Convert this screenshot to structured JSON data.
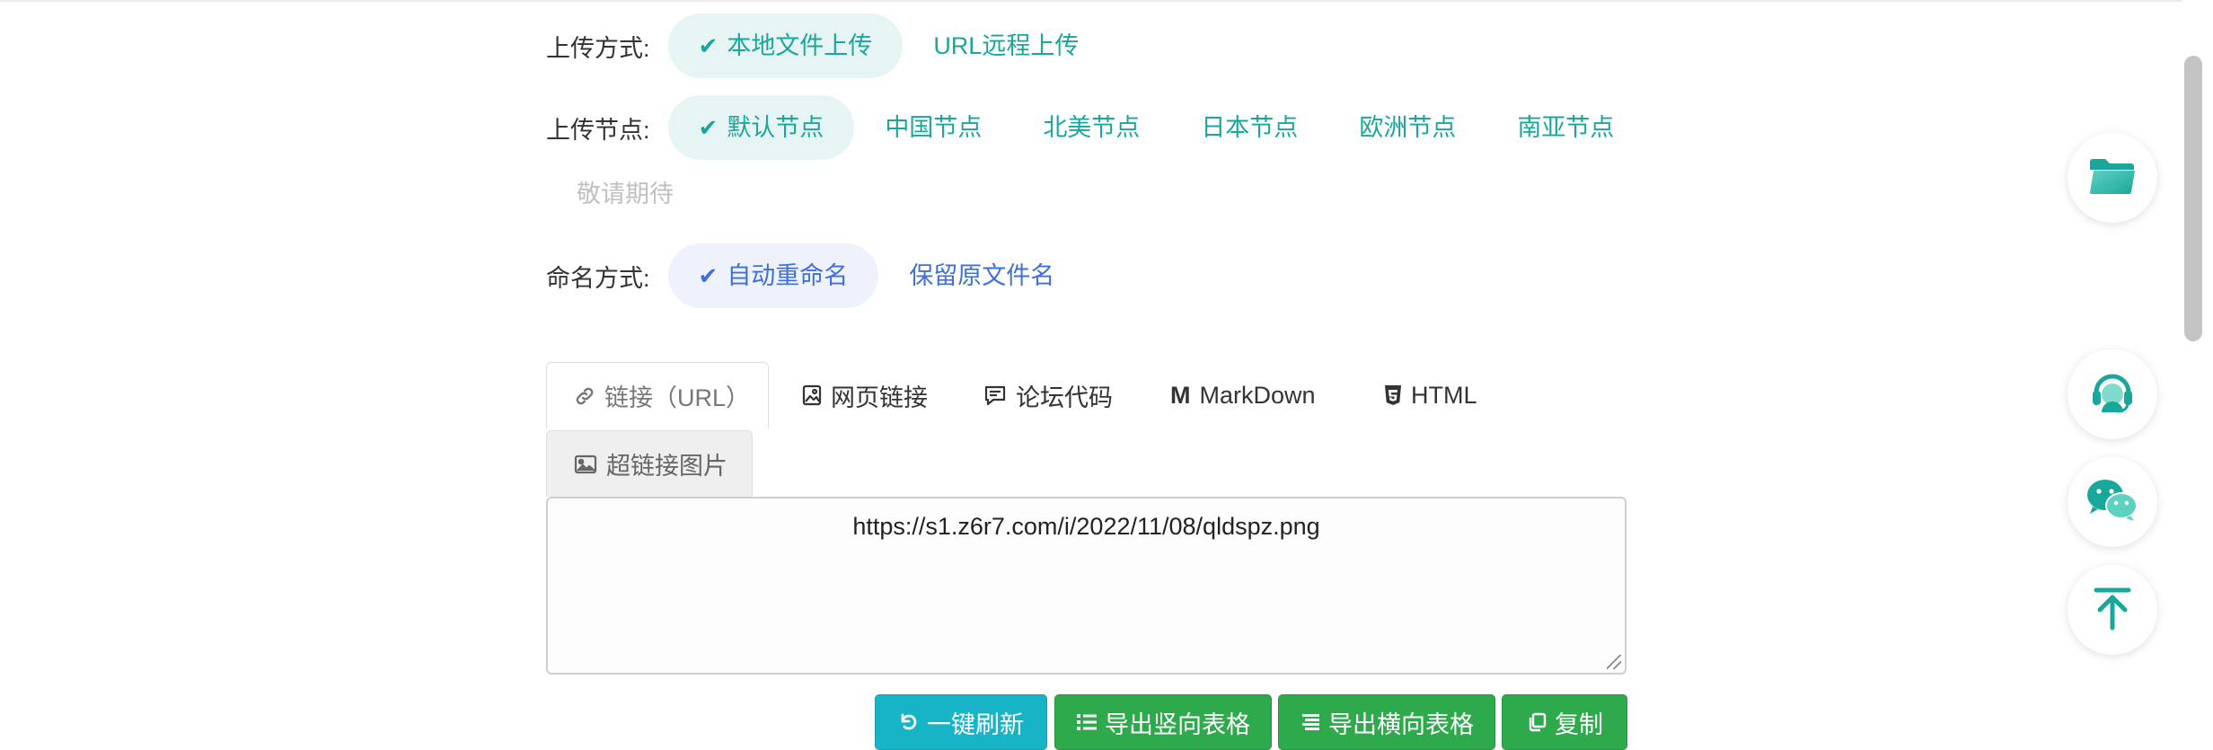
{
  "upload_method": {
    "label": "上传方式:",
    "options": [
      {
        "label": "本地文件上传",
        "active": true
      },
      {
        "label": "URL远程上传",
        "active": false
      }
    ]
  },
  "upload_node": {
    "label": "上传节点:",
    "options": [
      {
        "label": "默认节点",
        "active": true
      },
      {
        "label": "中国节点",
        "active": false
      },
      {
        "label": "北美节点",
        "active": false
      },
      {
        "label": "日本节点",
        "active": false
      },
      {
        "label": "欧洲节点",
        "active": false
      },
      {
        "label": "南亚节点",
        "active": false
      }
    ],
    "coming_soon": "敬请期待"
  },
  "naming": {
    "label": "命名方式:",
    "options": [
      {
        "label": "自动重命名",
        "active": true
      },
      {
        "label": "保留原文件名",
        "active": false
      }
    ]
  },
  "tabs": [
    {
      "label": "链接（URL）",
      "icon": "link-icon",
      "active": true
    },
    {
      "label": "网页链接",
      "icon": "image-file-icon",
      "active": false
    },
    {
      "label": "论坛代码",
      "icon": "comment-icon",
      "active": false
    },
    {
      "label": "MarkDown",
      "icon": "markdown-icon",
      "active": false
    },
    {
      "label": "HTML",
      "icon": "html5-icon",
      "active": false
    },
    {
      "label": "超链接图片",
      "icon": "picture-icon",
      "active": false
    }
  ],
  "output": {
    "value": "https://s1.z6r7.com/i/2022/11/08/qldspz.png"
  },
  "buttons": {
    "refresh": "一键刷新",
    "export_vertical": "导出竖向表格",
    "export_horizontal": "导出横向表格",
    "copy": "复制"
  },
  "float_buttons": [
    "folder-icon",
    "customer-service-icon",
    "wechat-icon",
    "back-to-top-icon"
  ],
  "colors": {
    "accent_green": "#1aa79b",
    "accent_blue": "#3f6fd8",
    "button_cyan": "#17b3c6",
    "button_green": "#2eaa4c"
  }
}
